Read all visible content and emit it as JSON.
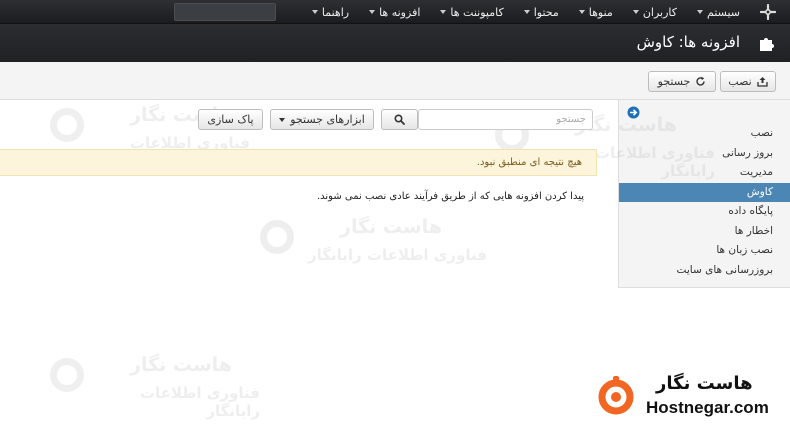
{
  "topbar": {
    "menu": [
      {
        "label": "سیستم"
      },
      {
        "label": "کاربران"
      },
      {
        "label": "منوها"
      },
      {
        "label": "محتوا"
      },
      {
        "label": "کامپوننت ها"
      },
      {
        "label": "افزونه ها"
      },
      {
        "label": "راهنما"
      }
    ]
  },
  "header": {
    "title": "افزونه ها: کاوش"
  },
  "toolbar": {
    "install_label": "نصب",
    "find_label": "جستجو"
  },
  "sidebar": {
    "items": [
      {
        "label": "نصب"
      },
      {
        "label": "بروز رسانی"
      },
      {
        "label": "مدیریت"
      },
      {
        "label": "کاوش",
        "active": true
      },
      {
        "label": "پایگاه داده"
      },
      {
        "label": "اخطار ها"
      },
      {
        "label": "نصب زبان ها"
      },
      {
        "label": "بروزرسانی های سایت"
      }
    ]
  },
  "filters": {
    "search_placeholder": "جستجو",
    "tools_label": "ابزارهای جستجو",
    "clear_label": "پاک سازی"
  },
  "alert": {
    "message": "هیچ نتیجه ای منطبق نبود."
  },
  "description": "پیدا کردن افزونه هایی که از طریق فرآیند عادی نصب نمی شوند.",
  "watermark": {
    "title": "هاست نگار",
    "subtitle": "فناوری اطلاعات رایانگار"
  },
  "brand": {
    "name_fa": "هاست نگار",
    "name_en": "Hostnegar.com"
  },
  "colors": {
    "accent": "#4b86b4",
    "brand_orange": "#f26522",
    "alert_bg": "#fcf5db"
  }
}
